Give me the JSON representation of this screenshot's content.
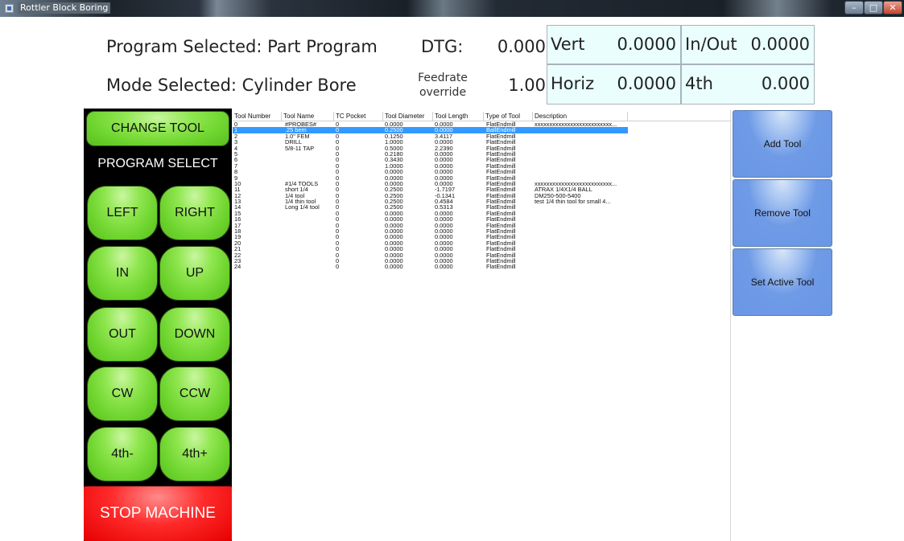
{
  "window": {
    "title": "Rottler Block Boring"
  },
  "header": {
    "program_selected": "Program Selected: Part Program",
    "mode_selected": "Mode Selected: Cylinder Bore",
    "dtg_label": "DTG:",
    "dtg_value": "0.000",
    "feedrate_label_line1": "Feedrate",
    "feedrate_label_line2": "override",
    "feedrate_value": "1.00",
    "vert_label": "Vert",
    "vert_value": "0.0000",
    "inout_label": "In/Out",
    "inout_value": "0.0000",
    "horiz_label": "Horiz",
    "horiz_value": "0.0000",
    "fourth_label": "4th",
    "fourth_value": "0.000"
  },
  "controls": {
    "change_tool": "CHANGE TOOL",
    "program_select": "PROGRAM SELECT",
    "left": "LEFT",
    "right": "RIGHT",
    "in": "IN",
    "up": "UP",
    "out": "OUT",
    "down": "DOWN",
    "cw": "CW",
    "ccw": "CCW",
    "fourth_minus": "4th-",
    "fourth_plus": "4th+",
    "stop": "STOP MACHINE"
  },
  "tool_table": {
    "columns": [
      "Tool Number",
      "Tool Name",
      "TC Pocket",
      "Tool Diameter",
      "Tool Length",
      "Type of Tool",
      "Description"
    ],
    "selected_index": 1,
    "rows": [
      [
        "0",
        "#PROBES#",
        "0",
        "0.0000",
        "0.0000",
        "FlatEndmill",
        "xxxxxxxxxxxxxxxxxxxxxxxxxx..."
      ],
      [
        "1",
        ".25 bem",
        "0",
        "0.2500",
        "0.0000",
        "BallEndmill",
        ""
      ],
      [
        "2",
        "1.0\" FEM",
        "0",
        "0.1250",
        "3.4117",
        "FlatEndmill",
        ""
      ],
      [
        "3",
        "DRILL",
        "0",
        "1.0000",
        "0.0000",
        "FlatEndmill",
        ""
      ],
      [
        "4",
        "5/8-11 TAP",
        "0",
        "0.5000",
        "2.2390",
        "FlatEndmill",
        ""
      ],
      [
        "5",
        "",
        "0",
        "0.2180",
        "0.0000",
        "FlatEndmill",
        ""
      ],
      [
        "6",
        "",
        "0",
        "0.3430",
        "0.0000",
        "FlatEndmill",
        ""
      ],
      [
        "7",
        "",
        "0",
        "1.0000",
        "0.0000",
        "FlatEndmill",
        ""
      ],
      [
        "8",
        "",
        "0",
        "0.0000",
        "0.0000",
        "FlatEndmill",
        ""
      ],
      [
        "9",
        "",
        "0",
        "0.0000",
        "0.0000",
        "FlatEndmill",
        ""
      ],
      [
        "10",
        "#1/4 TOOLS",
        "0",
        "0.0000",
        "0.0000",
        "FlatEndmill",
        "xxxxxxxxxxxxxxxxxxxxxxxxxx..."
      ],
      [
        "11",
        "short 1/4",
        "0",
        "0.2500",
        "-1.7197",
        "FlatEndmill",
        "ATRAX 1/4X1/4 BALL"
      ],
      [
        "12",
        "1/4 tool",
        "0",
        "0.2500",
        "-0.1341",
        "FlatEndmill",
        "DM250-500-5400"
      ],
      [
        "13",
        "1/4 thin tool",
        "0",
        "0.2500",
        "0.4584",
        "FlatEndmill",
        "test 1/4 thin tool for small 4..."
      ],
      [
        "14",
        "Long 1/4 tool",
        "0",
        "0.2500",
        "0.5313",
        "FlatEndmill",
        ""
      ],
      [
        "15",
        "",
        "0",
        "0.0000",
        "0.0000",
        "FlatEndmill",
        ""
      ],
      [
        "16",
        "",
        "0",
        "0.0000",
        "0.0000",
        "FlatEndmill",
        ""
      ],
      [
        "17",
        "",
        "0",
        "0.0000",
        "0.0000",
        "FlatEndmill",
        ""
      ],
      [
        "18",
        "",
        "0",
        "0.0000",
        "0.0000",
        "FlatEndmill",
        ""
      ],
      [
        "19",
        "",
        "0",
        "0.0000",
        "0.0000",
        "FlatEndmill",
        ""
      ],
      [
        "20",
        "",
        "0",
        "0.0000",
        "0.0000",
        "FlatEndmill",
        ""
      ],
      [
        "21",
        "",
        "0",
        "0.0000",
        "0.0000",
        "FlatEndmill",
        ""
      ],
      [
        "22",
        "",
        "0",
        "0.0000",
        "0.0000",
        "FlatEndmill",
        ""
      ],
      [
        "23",
        "",
        "0",
        "0.0000",
        "0.0000",
        "FlatEndmill",
        ""
      ],
      [
        "24",
        "",
        "0",
        "0.0000",
        "0.0000",
        "FlatEndmill",
        ""
      ]
    ]
  },
  "actions": {
    "add_tool": "Add Tool",
    "remove_tool": "Remove Tool",
    "set_active_tool": "Set Active Tool"
  }
}
